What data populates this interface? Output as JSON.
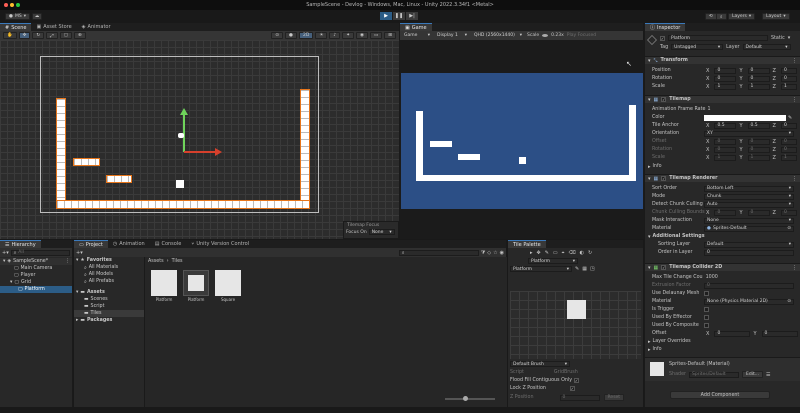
{
  "titlebar": {
    "title": "SampleScene - Devlog - Windows, Mac, Linux - Unity 2022.3.34f1 <Metal>",
    "account_label": "MS",
    "layers_label": "Layers",
    "layout_label": "Layout"
  },
  "scene_tabs": [
    "Scene",
    "Asset Store",
    "Animator"
  ],
  "scene_toolbar": {
    "mode_2d": "2D"
  },
  "tilemap_focus": {
    "title": "Tilemap Focus",
    "focus_on_label": "Focus On",
    "focus_on_value": "None"
  },
  "game": {
    "tab": "Game",
    "display_mode": "Game",
    "display": "Display 1",
    "resolution": "QHD (2560x1440)",
    "scale_label": "Scale",
    "scale_value": "0.23x",
    "play_focused": "Play Focused",
    "bg_color": "#2c4f86"
  },
  "hierarchy": {
    "tab": "Hierarchy",
    "search_placeholder": "All",
    "items": [
      {
        "label": "SampleScene*"
      },
      {
        "label": "Main Camera"
      },
      {
        "label": "Player"
      },
      {
        "label": "Grid"
      },
      {
        "label": "Platform"
      }
    ]
  },
  "project": {
    "tabs": [
      "Project",
      "Animation",
      "Console",
      "Unity Version Control"
    ],
    "favorites": [
      "Favorites",
      "All Materials",
      "All Models",
      "All Prefabs"
    ],
    "assets": [
      "Assets",
      "Scenes",
      "Script",
      "Tiles",
      "Packages"
    ],
    "breadcrumb": [
      "Assets",
      "Tiles"
    ],
    "items": [
      {
        "label": "Platform"
      },
      {
        "label": "Platform"
      },
      {
        "label": "Square"
      }
    ]
  },
  "palette": {
    "tab": "Tile Palette",
    "active_tilemap": "Platform",
    "palette_name": "Platform",
    "brush": "Default Brush",
    "script_label": "Script",
    "script_value": "GridBrush",
    "flood_fill": "Flood Fill Contiguous Only",
    "lock_z": "Lock Z Position",
    "z_position": "Z Position",
    "z_value": "0",
    "reset": "Reset"
  },
  "inspector": {
    "tab": "Inspector",
    "object_name": "Platform",
    "static_label": "Static",
    "tag_label": "Tag",
    "tag_value": "Untagged",
    "layer_label": "Layer",
    "layer_value": "Default",
    "transform": {
      "title": "Transform",
      "position_label": "Position",
      "rotation_label": "Rotation",
      "scale_label": "Scale",
      "position": [
        "0",
        "0",
        "0"
      ],
      "rotation": [
        "0",
        "0",
        "0"
      ],
      "scale": [
        "1",
        "1",
        "1"
      ]
    },
    "tilemap": {
      "title": "Tilemap",
      "frame_rate_label": "Animation Frame Rate",
      "frame_rate": "1",
      "color_label": "Color",
      "anchor_label": "Tile Anchor",
      "anchor": [
        "0.5",
        "0.5",
        "0"
      ],
      "orientation_label": "Orientation",
      "orientation": "XY",
      "offset_label": "Offset",
      "offset": [
        "0",
        "0",
        "0"
      ],
      "rotation_label": "Rotation",
      "rotation": [
        "0",
        "0",
        "0"
      ],
      "scale_label": "Scale",
      "scale": [
        "1",
        "1",
        "1"
      ],
      "info_label": "Info"
    },
    "renderer": {
      "title": "Tilemap Renderer",
      "sort_order_label": "Sort Order",
      "sort_order": "Bottom Left",
      "mode_label": "Mode",
      "mode": "Chunk",
      "detect_label": "Detect Chunk Culling",
      "detect": "Auto",
      "bounds_label": "Chunk Culling Bounds",
      "bounds": [
        "0",
        "0",
        "0"
      ],
      "mask_label": "Mask Interaction",
      "mask": "None",
      "material_label": "Material",
      "material": "Sprites-Default",
      "additional_label": "Additional Settings",
      "sorting_layer_label": "Sorting Layer",
      "sorting_layer": "Default",
      "order_label": "Order in Layer",
      "order": "0"
    },
    "collider": {
      "title": "Tilemap Collider 2D",
      "max_tile_label": "Max Tile Change Cou",
      "max_tile": "1000",
      "extrusion_label": "Extrusion Factor",
      "extrusion": "0",
      "delaunay_label": "Use Delaunay Mesh",
      "material_label": "Material",
      "material": "None (Physics Material 2D)",
      "trigger_label": "Is Trigger",
      "effector_label": "Used By Effector",
      "composite_label": "Used By Composite",
      "offset_label": "Offset",
      "offset": [
        "0",
        "0"
      ],
      "overrides_label": "Layer Overrides",
      "info_label": "Info"
    },
    "material_footer": {
      "name": "Sprites-Default (Material)",
      "shader_label": "Shader",
      "shader": "Sprites/Default",
      "edit": "Edit..."
    },
    "add_component": "Add Component"
  }
}
